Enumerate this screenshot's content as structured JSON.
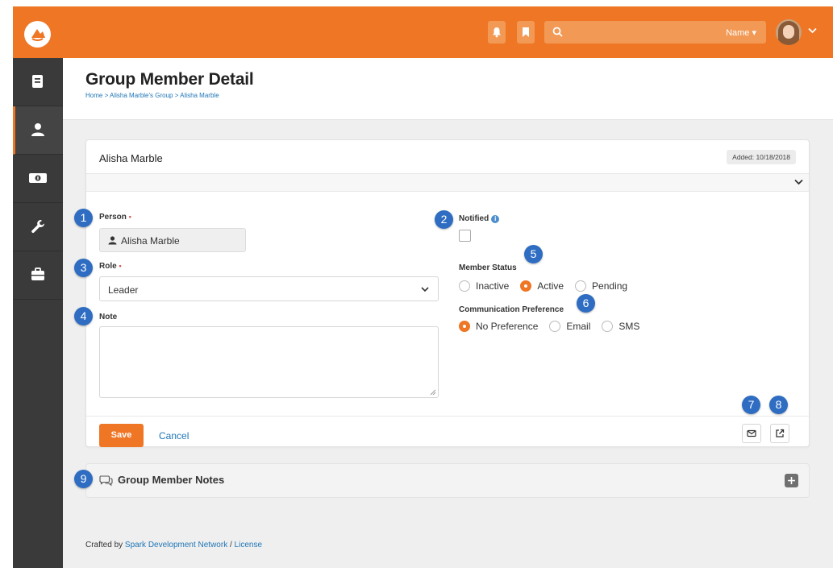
{
  "header": {
    "search_scope_label": "Name ▾",
    "search_placeholder": ""
  },
  "page": {
    "title": "Group Member Detail",
    "breadcrumb": [
      {
        "label": "Home"
      },
      {
        "label": "Alisha Marble's Group"
      },
      {
        "label": "Alisha Marble"
      }
    ],
    "breadcrumb_separator": ">"
  },
  "member_card": {
    "title": "Alisha Marble",
    "added_label": "Added: 10/18/2018",
    "fields": {
      "person_label": "Person",
      "person_value": "Alisha Marble",
      "notified_label": "Notified",
      "notified_checked": false,
      "role_label": "Role",
      "role_value": "Leader",
      "note_label": "Note",
      "note_value": "",
      "required_marker": "•",
      "member_status_label": "Member Status",
      "member_status_options": [
        "Inactive",
        "Active",
        "Pending"
      ],
      "member_status_selected": "Active",
      "comm_pref_label": "Communication Preference",
      "comm_pref_options": [
        "No Preference",
        "Email",
        "SMS"
      ],
      "comm_pref_selected": "No Preference"
    },
    "actions": {
      "save_label": "Save",
      "cancel_label": "Cancel"
    }
  },
  "notes_panel": {
    "title": "Group Member Notes"
  },
  "footer": {
    "prefix": "Crafted by ",
    "org_link": "Spark Development Network",
    "separator": " / ",
    "license_link": "License"
  },
  "callouts": [
    "1",
    "2",
    "3",
    "4",
    "5",
    "6",
    "7",
    "8",
    "9"
  ],
  "colors": {
    "brand_orange": "#ee7625",
    "sidebar_dark": "#3a3a3a",
    "link_blue": "#1f75b6",
    "callout_blue": "#2e6dc2"
  },
  "icons": {
    "logo": "rock-logo-icon",
    "notifications": "bell-icon",
    "bookmarks": "bookmark-icon",
    "search": "search-icon",
    "sidebar": [
      "book-icon",
      "user-icon",
      "money-icon",
      "wrench-icon",
      "briefcase-icon"
    ],
    "email": "envelope-icon",
    "open_external": "external-link-icon",
    "notes": "comments-icon",
    "add": "plus-icon"
  }
}
